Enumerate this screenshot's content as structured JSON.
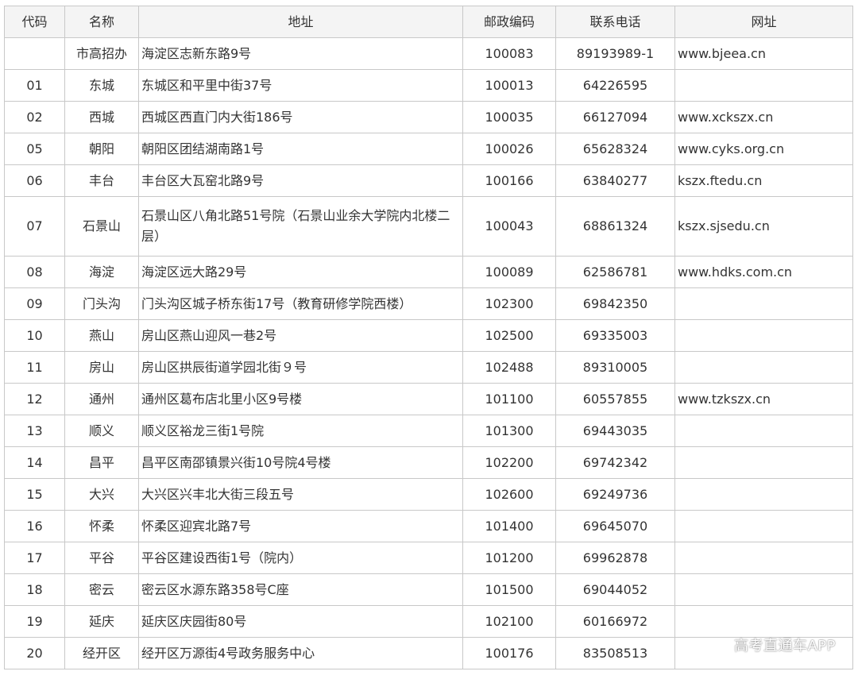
{
  "table": {
    "headers": [
      "代码",
      "名称",
      "地址",
      "邮政编码",
      "联系电话",
      "网址"
    ],
    "rows": [
      {
        "code": "",
        "name": "市高招办",
        "address": "海淀区志新东路9号",
        "zip": "100083",
        "phone": "89193989-1",
        "website": "www.bjeea.cn"
      },
      {
        "code": "01",
        "name": "东城",
        "address": "东城区和平里中街37号",
        "zip": "100013",
        "phone": "64226595",
        "website": ""
      },
      {
        "code": "02",
        "name": "西城",
        "address": "西城区西直门内大街186号",
        "zip": "100035",
        "phone": "66127094",
        "website": "www.xckszx.cn"
      },
      {
        "code": "05",
        "name": "朝阳",
        "address": "朝阳区团结湖南路1号",
        "zip": "100026",
        "phone": "65628324",
        "website": "www.cyks.org.cn"
      },
      {
        "code": "06",
        "name": "丰台",
        "address": "丰台区大瓦窑北路9号",
        "zip": "100166",
        "phone": "63840277",
        "website": "kszx.ftedu.cn"
      },
      {
        "code": "07",
        "name": "石景山",
        "address": "石景山区八角北路51号院（石景山业余大学院内北楼二层）",
        "zip": "100043",
        "phone": "68861324",
        "website": "kszx.sjsedu.cn"
      },
      {
        "code": "08",
        "name": "海淀",
        "address": "海淀区远大路29号",
        "zip": "100089",
        "phone": "62586781",
        "website": "www.hdks.com.cn"
      },
      {
        "code": "09",
        "name": "门头沟",
        "address": "门头沟区城子桥东街17号（教育研修学院西楼）",
        "zip": "102300",
        "phone": "69842350",
        "website": ""
      },
      {
        "code": "10",
        "name": "燕山",
        "address": "房山区燕山迎风一巷2号",
        "zip": "102500",
        "phone": "69335003",
        "website": ""
      },
      {
        "code": "11",
        "name": "房山",
        "address": "房山区拱辰街道学园北街９号",
        "zip": "102488",
        "phone": "89310005",
        "website": ""
      },
      {
        "code": "12",
        "name": "通州",
        "address": "通州区葛布店北里小区9号楼",
        "zip": "101100",
        "phone": "60557855",
        "website": "www.tzkszx.cn"
      },
      {
        "code": "13",
        "name": "顺义",
        "address": "顺义区裕龙三街1号院",
        "zip": "101300",
        "phone": "69443035",
        "website": ""
      },
      {
        "code": "14",
        "name": "昌平",
        "address": "昌平区南邵镇景兴街10号院4号楼",
        "zip": "102200",
        "phone": "69742342",
        "website": ""
      },
      {
        "code": "15",
        "name": "大兴",
        "address": "大兴区兴丰北大街三段五号",
        "zip": "102600",
        "phone": "69249736",
        "website": ""
      },
      {
        "code": "16",
        "name": "怀柔",
        "address": "怀柔区迎宾北路7号",
        "zip": "101400",
        "phone": "69645070",
        "website": ""
      },
      {
        "code": "17",
        "name": "平谷",
        "address": "平谷区建设西街1号（院内）",
        "zip": "101200",
        "phone": "69962878",
        "website": ""
      },
      {
        "code": "18",
        "name": "密云",
        "address": "密云区水源东路358号C座",
        "zip": "101500",
        "phone": "69044052",
        "website": ""
      },
      {
        "code": "19",
        "name": "延庆",
        "address": "延庆区庆园街80号",
        "zip": "102100",
        "phone": "60166972",
        "website": ""
      },
      {
        "code": "20",
        "name": "经开区",
        "address": "经开区万源街4号政务服务中心",
        "zip": "100176",
        "phone": "83508513",
        "website": ""
      }
    ]
  },
  "watermark": "高考直通车APP"
}
